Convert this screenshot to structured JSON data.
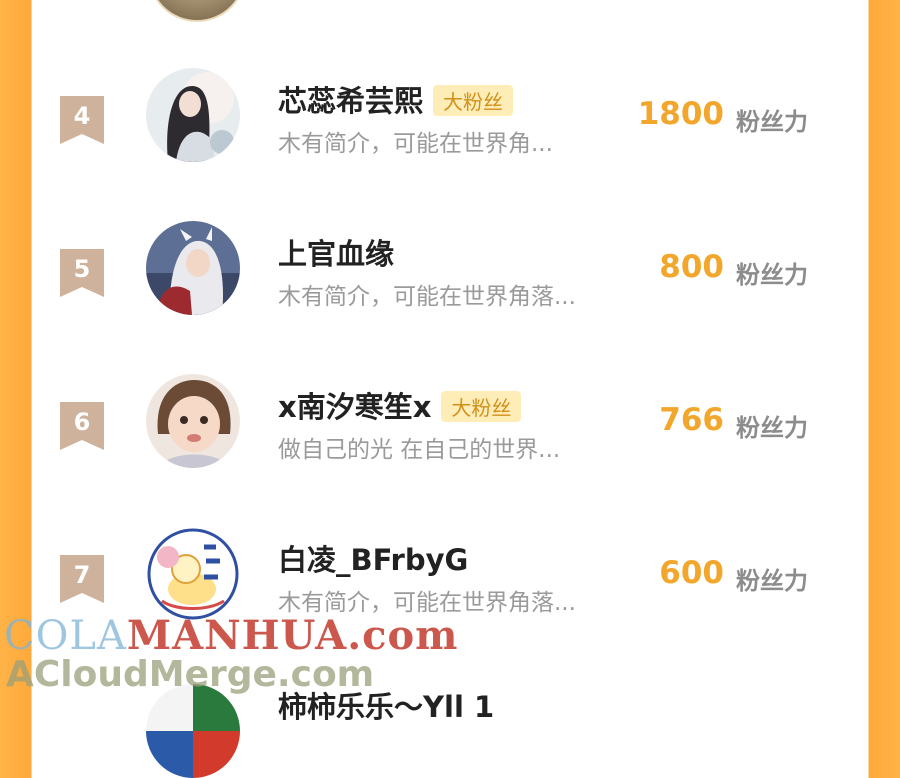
{
  "score_unit": "粉丝力",
  "badge_label": "大粉丝",
  "rows": [
    {
      "rank": "4",
      "name": "芯蕊希芸熙",
      "badge": true,
      "bio": "木有简介，可能在世界角...",
      "score": "1800"
    },
    {
      "rank": "5",
      "name": "上官血缘",
      "badge": false,
      "bio": "木有简介，可能在世界角落...",
      "score": "800"
    },
    {
      "rank": "6",
      "name": "x南汐寒笙x",
      "badge": true,
      "bio": "做自己的光 在自己的世界...",
      "score": "766"
    },
    {
      "rank": "7",
      "name": "白凌_BFrbyG",
      "badge": false,
      "bio": "木有简介，可能在世界角落...",
      "score": "600"
    }
  ],
  "partial_row": {
    "name": "柿柿乐乐～Yll 1"
  },
  "watermark": {
    "line1_a": "COLA",
    "line1_b": "MANHUA.com",
    "line2": "ACloudMerge.com"
  },
  "colors": {
    "accent": "#f2a62c",
    "side_bars": "#ffa93a",
    "badge_bg": "#ffedb8",
    "badge_text": "#d0901a",
    "rank_tag": "#cfb29b"
  }
}
